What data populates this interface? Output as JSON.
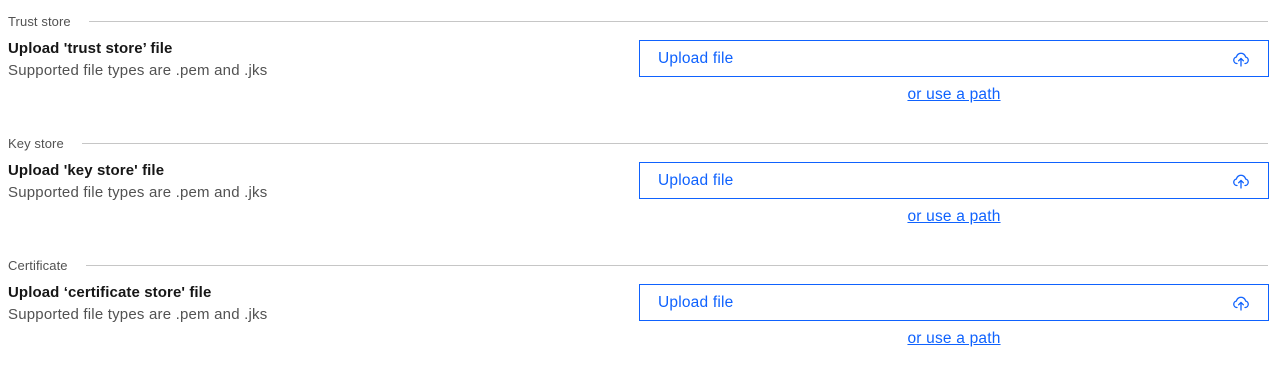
{
  "sections": [
    {
      "title": "Trust store",
      "heading": "Upload 'trust store’ file",
      "helper": "Supported file types are .pem and .jks",
      "upload_label": "Upload file",
      "upload_icon": "cloud-upload-icon",
      "path_link": "or use a path"
    },
    {
      "title": "Key store",
      "heading": "Upload 'key store' file",
      "helper": "Supported file types are .pem and .jks",
      "upload_label": "Upload file",
      "upload_icon": "cloud-upload-icon",
      "path_link": "or use a path"
    },
    {
      "title": "Certificate",
      "heading": "Upload ‘certificate store' file",
      "helper": "Supported file types are .pem and .jks",
      "upload_label": "Upload file",
      "upload_icon": "cloud-upload-icon",
      "path_link": "or use a path"
    }
  ],
  "colors": {
    "accent": "#0f62fe",
    "text_primary": "#161616",
    "text_secondary": "#525252",
    "divider": "#c6c6c6"
  }
}
